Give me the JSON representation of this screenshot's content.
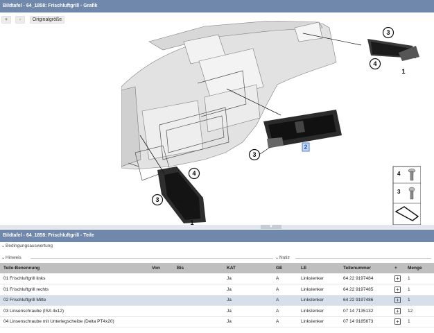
{
  "graphic_panel": {
    "title": "Bildtafel - 64_1858: Frischluftgrill - Grafik",
    "zoom_in": "+",
    "zoom_out": "-",
    "original_size": "Originalgröße"
  },
  "diagram": {
    "callouts": [
      "3",
      "4",
      "1",
      "2",
      "3",
      "4",
      "3",
      "1"
    ],
    "legend": [
      "4",
      "3"
    ]
  },
  "parts_panel": {
    "title": "Bildtafel - 64_1858: Frischluftgrill - Teile",
    "conditions": "Bedingungsauswertung",
    "hint": "Hinweis",
    "note": "Notiz",
    "columns": [
      "Teile-Benennung",
      "Von",
      "Bis",
      "KAT",
      "GE",
      "LE",
      "Teilenummer",
      "+",
      "Menge"
    ],
    "rows": [
      {
        "name": "01 Frischluftgrill links",
        "von": "",
        "bis": "",
        "kat": "Ja",
        "ge": "A",
        "le": "Linkslenker",
        "part": "64 22 9197484",
        "qty": "1"
      },
      {
        "name": "01 Frischluftgrill rechts",
        "von": "",
        "bis": "",
        "kat": "Ja",
        "ge": "A",
        "le": "Linkslenker",
        "part": "64 22 9197485",
        "qty": "1"
      },
      {
        "name": "02 Frischluftgrill Mitte",
        "von": "",
        "bis": "",
        "kat": "Ja",
        "ge": "A",
        "le": "Linkslenker",
        "part": "64 22 9197486",
        "qty": "1"
      },
      {
        "name": "03 Linsenschraube (ISA 4x12)",
        "von": "",
        "bis": "",
        "kat": "Ja",
        "ge": "A",
        "le": "Linkslenker",
        "part": "07 14 7135132",
        "qty": "12"
      },
      {
        "name": "04 Linsenschraube mit Unterlegscheibe (Delta PT4x20)",
        "von": "",
        "bis": "",
        "kat": "Ja",
        "ge": "A",
        "le": "Linkslenker",
        "part": "07 14 9185673",
        "qty": "1"
      }
    ],
    "selected_row": 2
  },
  "colors": {
    "title_bar": "#6f88ab",
    "header_bg": "#bfbfbf",
    "selected_row": "#d6dfea",
    "highlight_callout": "#2a62c8"
  }
}
